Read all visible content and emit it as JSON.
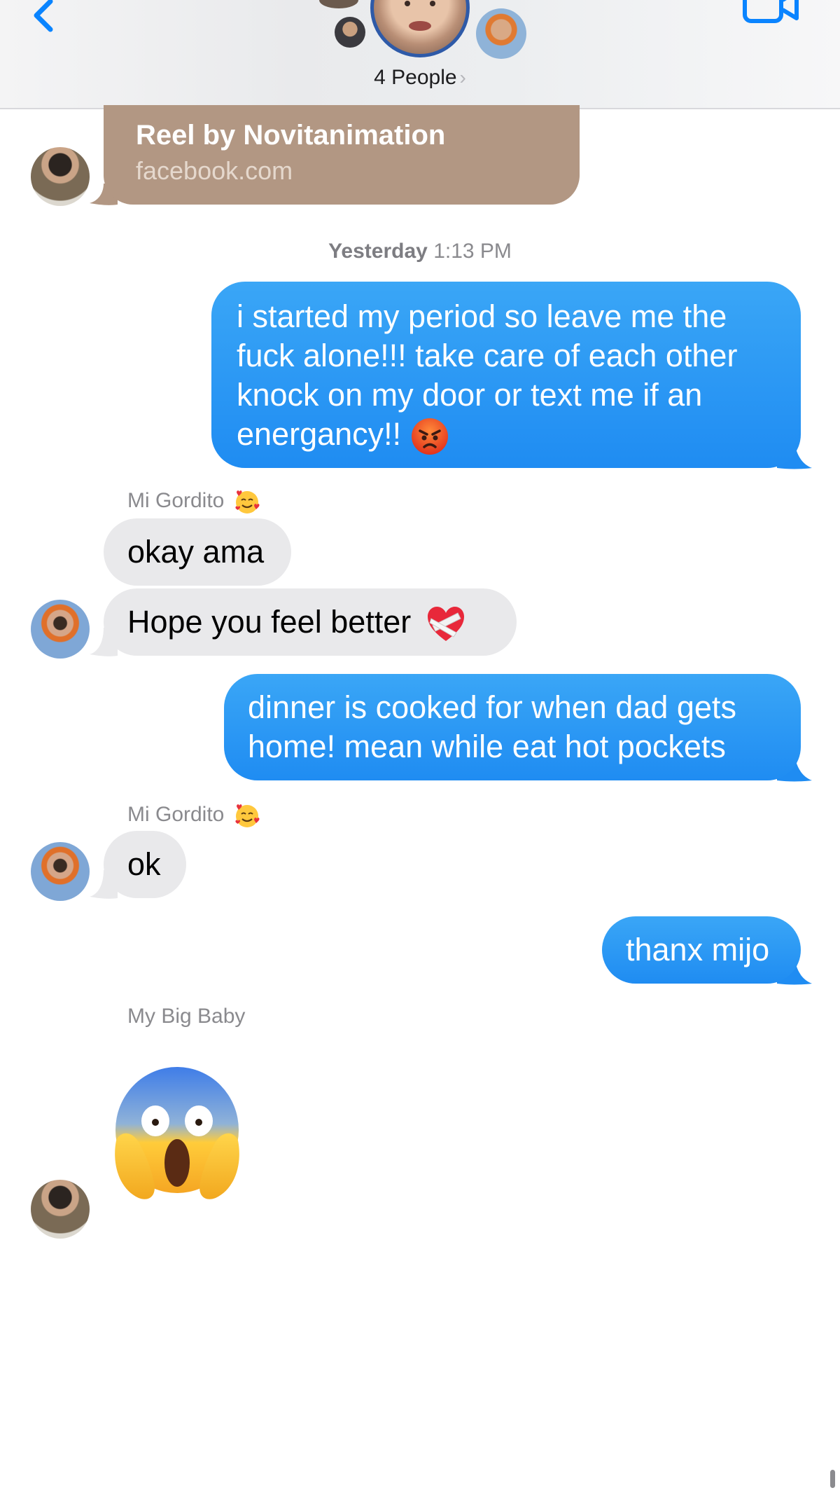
{
  "header": {
    "people_label": "4 People",
    "chevron": "›"
  },
  "link_preview": {
    "title": "Reel by Novitanimation",
    "domain": "facebook.com"
  },
  "timestamp": {
    "day": "Yesterday",
    "time": "1:13 PM"
  },
  "messages": [
    {
      "direction": "out",
      "text": "i started my period so leave me the fuck alone!!! take care of each other knock on my door or text me if an energancy!!",
      "emoji": "angry-face"
    },
    {
      "direction": "in",
      "sender": "Mi Gordito",
      "text": "okay ama"
    },
    {
      "direction": "in",
      "text": "Hope you feel better",
      "emoji": "mending-heart"
    },
    {
      "direction": "out",
      "text": "dinner is cooked for when dad gets home! mean while eat hot pockets"
    },
    {
      "direction": "in",
      "sender": "Mi Gordito",
      "text": "ok"
    },
    {
      "direction": "out",
      "text": "thanx mijo"
    },
    {
      "direction": "in",
      "sender": "My Big Baby",
      "emoji": "screaming-face"
    }
  ],
  "out_lines": {
    "m1": [
      "i started my period so leave me the",
      "fuck alone!!! take care of each other",
      "knock on my door or text me if an",
      "energancy!!"
    ],
    "m4": [
      "dinner is cooked for when dad gets",
      "home! mean while eat hot pockets"
    ]
  },
  "colors": {
    "outgoing": "#1f8cf2",
    "incoming": "#e9e9eb",
    "link_card": "#b29783",
    "accent": "#0a84ff"
  },
  "icons": [
    "back-chevron-icon",
    "video-call-icon",
    "chevron-right-icon",
    "smiling-face-with-hearts-icon"
  ]
}
